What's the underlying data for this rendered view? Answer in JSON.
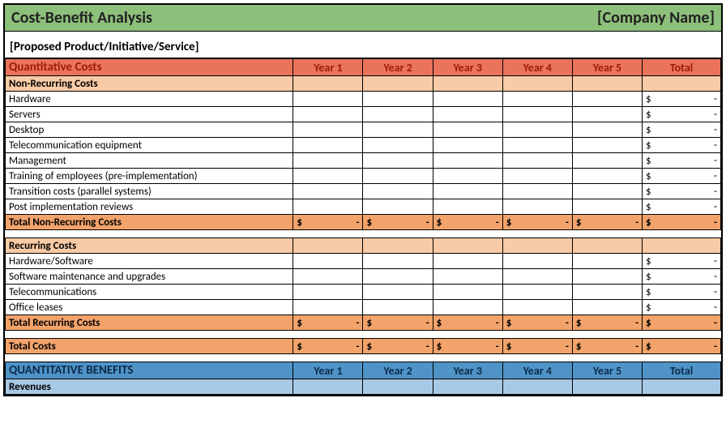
{
  "title_left": "Cost-Benefit Analysis",
  "title_right": "[Company Name]",
  "subtitle": "[Proposed Product/Initiative/Service]",
  "years": [
    "Year 1",
    "Year 2",
    "Year 3",
    "Year 4",
    "Year 5"
  ],
  "total_label": "Total",
  "sections": {
    "quant_costs_header": "Quantitative Costs",
    "non_recurring": {
      "header": "Non-Recurring Costs",
      "rows": [
        "Hardware",
        "Servers",
        "Desktop",
        "Telecommunication equipment",
        "Management",
        "Training of employees (pre-implementation)",
        "Transition costs (parallel systems)",
        "Post implementation reviews"
      ],
      "total_label": "Total Non-Recurring Costs"
    },
    "recurring": {
      "header": "Recurring Costs",
      "rows": [
        "Hardware/Software",
        "Software maintenance and upgrades",
        "Telecommunications",
        "Office leases"
      ],
      "total_label": "Total Recurring Costs"
    },
    "total_costs_label": "Total Costs",
    "benefits_header": "QUANTITATIVE BENEFITS",
    "revenues_label": "Revenues"
  },
  "money_placeholder": {
    "symbol": "$",
    "dash": "-"
  }
}
